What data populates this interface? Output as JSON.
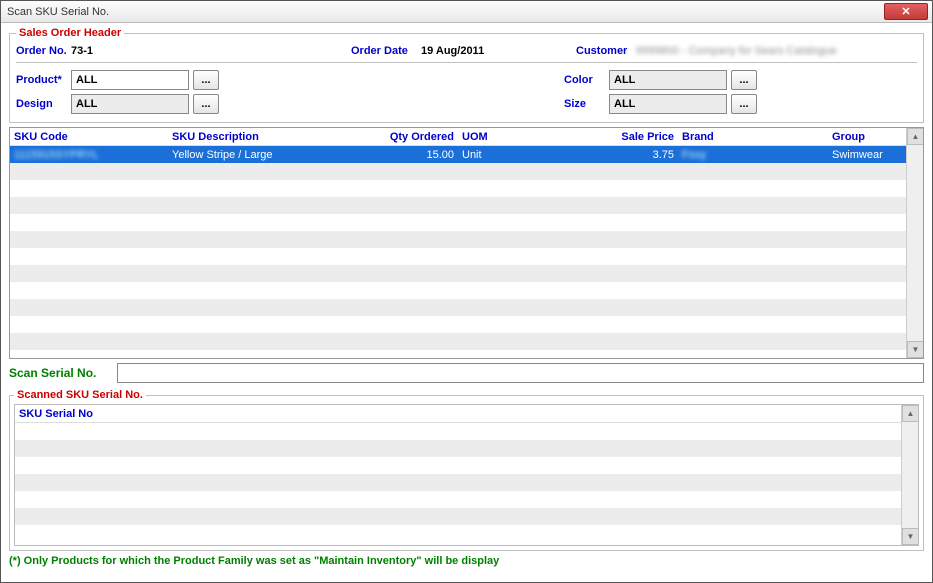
{
  "window": {
    "title": "Scan SKU Serial No."
  },
  "header": {
    "legend": "Sales Order Header",
    "labels": {
      "order_no": "Order No.",
      "order_date": "Order Date",
      "customer": "Customer",
      "product": "Product*",
      "color": "Color",
      "design": "Design",
      "size": "Size"
    },
    "values": {
      "order_no": "73-1",
      "order_date": "19 Aug/2011",
      "customer": "9999800 - Company for Sears Catalogue",
      "product": "ALL",
      "color": "ALL",
      "design": "ALL",
      "size": "ALL"
    },
    "ellipsis": "..."
  },
  "grid": {
    "columns": {
      "sku_code": "SKU Code",
      "sku_desc": "SKU Description",
      "qty": "Qty Ordered",
      "uom": "UOM",
      "price": "Sale Price",
      "brand": "Brand",
      "group": "Group"
    },
    "rows": [
      {
        "sku_code": "1115915SYPRYL",
        "sku_desc": "Yellow Stripe / Large",
        "qty": "15.00",
        "uom": "Unit",
        "price": "3.75",
        "brand": "Foxy",
        "group": "Swimwear",
        "selected": true
      }
    ]
  },
  "scan": {
    "label": "Scan Serial No.",
    "value": ""
  },
  "scanned": {
    "legend": "Scanned SKU Serial No.",
    "columns": {
      "serial": "SKU Serial No"
    },
    "rows": []
  },
  "footer": {
    "note": "(*) Only Products for which the Product Family was set as \"Maintain Inventory\" will be display"
  }
}
